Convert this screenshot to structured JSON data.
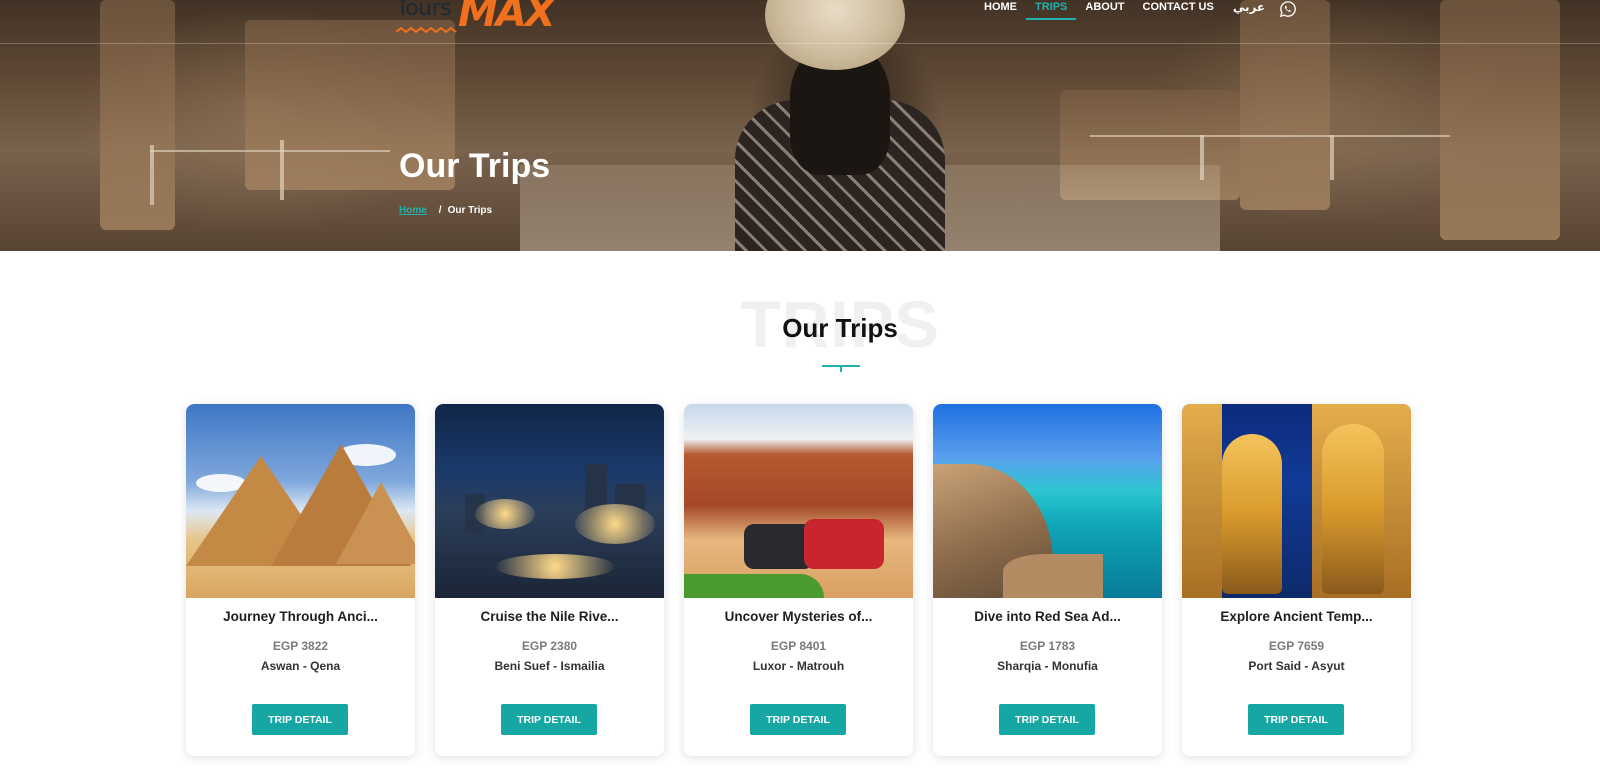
{
  "colors": {
    "accent": "#1fb3b0",
    "button": "#16a7a5",
    "logo_orange": "#f0701e"
  },
  "logo": {
    "line1": "Tours",
    "line2": "MAX"
  },
  "nav": {
    "items": [
      {
        "label": "HOME",
        "active": false
      },
      {
        "label": "TRIPS",
        "active": true
      },
      {
        "label": "ABOUT",
        "active": false
      },
      {
        "label": "CONTACT US",
        "active": false
      }
    ],
    "lang": "عربي",
    "whatsapp_icon": "whatsapp-icon"
  },
  "hero": {
    "title": "Our Trips",
    "breadcrumb": {
      "home": "Home",
      "separator": "/",
      "current": "Our Trips"
    }
  },
  "section": {
    "bg_word": "TRIPS",
    "title": "Our Trips"
  },
  "trips": [
    {
      "title": "Journey Through Anci...",
      "price": "EGP 3822",
      "route": "Aswan - Qena",
      "button": "TRIP DETAIL",
      "image": "pyramids-photo"
    },
    {
      "title": "Cruise the Nile Rive...",
      "price": "EGP 2380",
      "route": "Beni Suef - Ismailia",
      "button": "TRIP DETAIL",
      "image": "nile-night-photo"
    },
    {
      "title": "Uncover Mysteries of...",
      "price": "EGP 8401",
      "route": "Luxor - Matrouh",
      "button": "TRIP DETAIL",
      "image": "desert-quad-photo"
    },
    {
      "title": "Dive into Red Sea Ad...",
      "price": "EGP 1783",
      "route": "Sharqia - Monufia",
      "button": "TRIP DETAIL",
      "image": "red-sea-photo"
    },
    {
      "title": "Explore Ancient Temp...",
      "price": "EGP 7659",
      "route": "Port Said - Asyut",
      "button": "TRIP DETAIL",
      "image": "temple-photo"
    }
  ]
}
